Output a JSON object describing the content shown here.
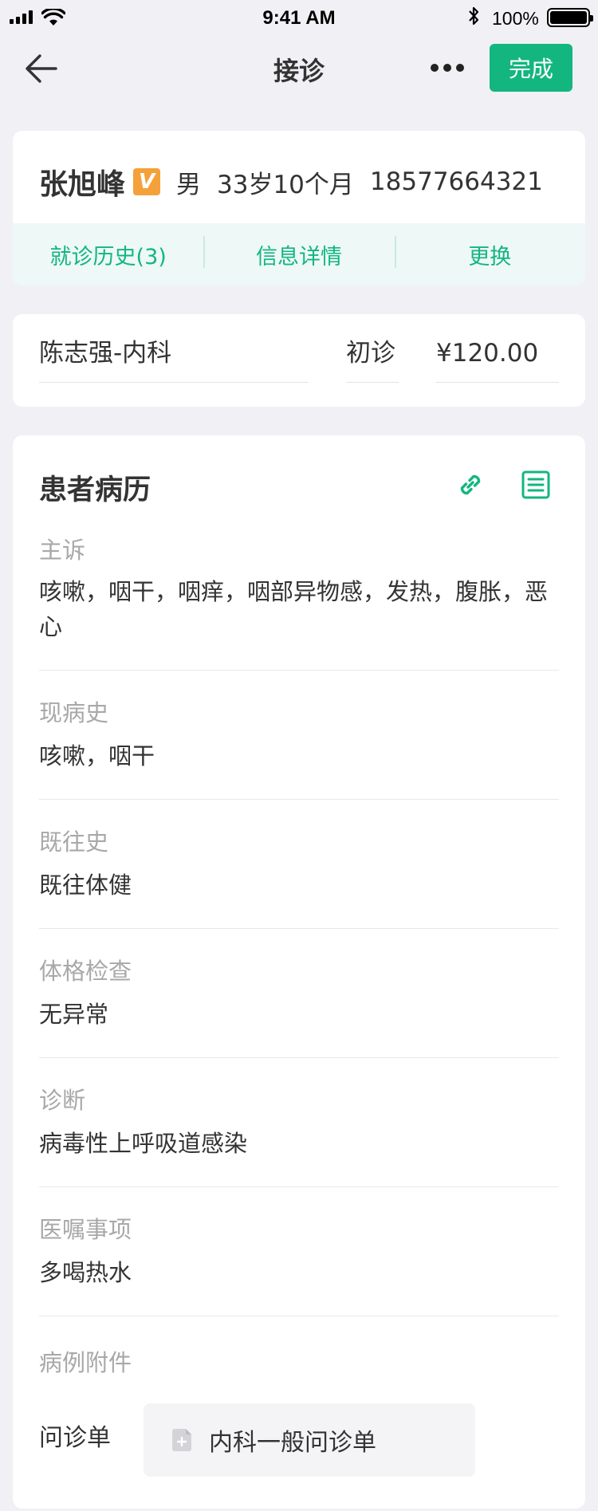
{
  "status_bar": {
    "time": "9:41 AM",
    "battery": "100%"
  },
  "nav": {
    "title": "接诊",
    "done_label": "完成"
  },
  "patient": {
    "name": "张旭峰",
    "vip_badge": "V",
    "gender": "男",
    "age": "33岁10个月",
    "phone": "18577664321",
    "tabs": [
      {
        "label": "就诊历史(3)"
      },
      {
        "label": "信息详情"
      },
      {
        "label": "更换"
      }
    ]
  },
  "visit": {
    "doctor": "陈志强-内科",
    "visit_type": "初诊",
    "fee": "¥120.00"
  },
  "record": {
    "title": "患者病历",
    "fields": [
      {
        "label": "主诉",
        "value": "咳嗽，咽干，咽痒，咽部异物感，发热，腹胀，恶心"
      },
      {
        "label": "现病史",
        "value": "咳嗽，咽干"
      },
      {
        "label": "既往史",
        "value": "既往体健"
      },
      {
        "label": "体格检查",
        "value": "无异常"
      },
      {
        "label": "诊断",
        "value": "病毒性上呼吸道感染"
      },
      {
        "label": "医嘱事项",
        "value": "多喝热水"
      }
    ],
    "attachments_label": "病例附件",
    "form_label": "问诊单",
    "form_file": "内科一般问诊单"
  },
  "colors": {
    "accent": "#13b67e",
    "vip": "#f5a13a",
    "background": "#f0f0f5"
  },
  "icons": [
    "back-arrow-icon",
    "more-icon",
    "link-icon",
    "list-icon",
    "document-icon"
  ]
}
